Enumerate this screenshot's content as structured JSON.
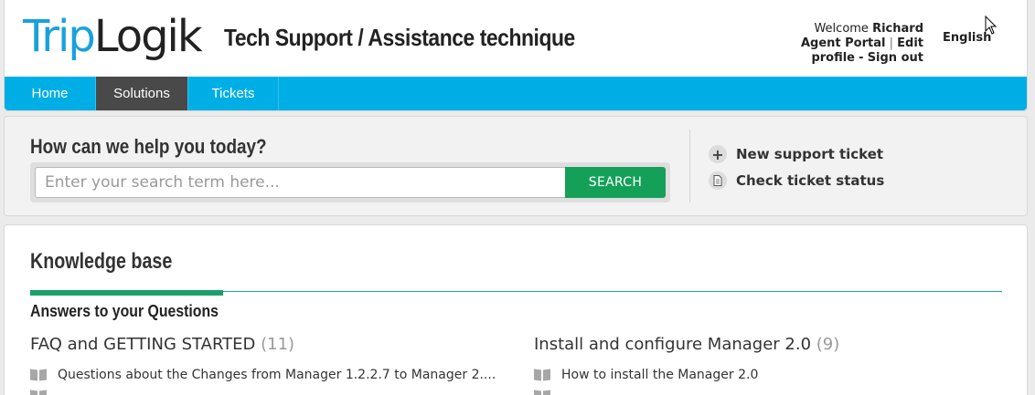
{
  "header": {
    "logo_part1": "Trip",
    "logo_part2": "Logik",
    "portal_title": "Tech Support / Assistance technique",
    "welcome": "Welcome",
    "user_name": "Richard",
    "agent_portal": "Agent Portal",
    "separator": "|",
    "edit": "Edit",
    "profile": "profile",
    "dash": "-",
    "sign_out": "Sign out",
    "language": "English"
  },
  "nav": {
    "items": [
      {
        "label": "Home"
      },
      {
        "label": "Solutions"
      },
      {
        "label": "Tickets"
      }
    ],
    "active": "Solutions"
  },
  "search": {
    "heading": "How can we help you today?",
    "placeholder": "Enter your search term here...",
    "button": "SEARCH"
  },
  "actions": {
    "new_ticket": "New support ticket",
    "check_status": "Check ticket status"
  },
  "knowledge_base": {
    "title": "Knowledge base",
    "subtitle": "Answers to your Questions",
    "categories": [
      {
        "name": "FAQ and GETTING STARTED",
        "count": "(11)",
        "articles": [
          "Questions about the Changes from Manager 1.2.2.7 to Manager 2...."
        ]
      },
      {
        "name": "Install and configure Manager 2.0",
        "count": "(9)",
        "articles": [
          "How to install the Manager 2.0"
        ]
      }
    ]
  },
  "colors": {
    "brand_blue": "#00aee6",
    "nav_active": "#494949",
    "search_button": "#14a058",
    "accent_rule": "#1aa06c"
  }
}
